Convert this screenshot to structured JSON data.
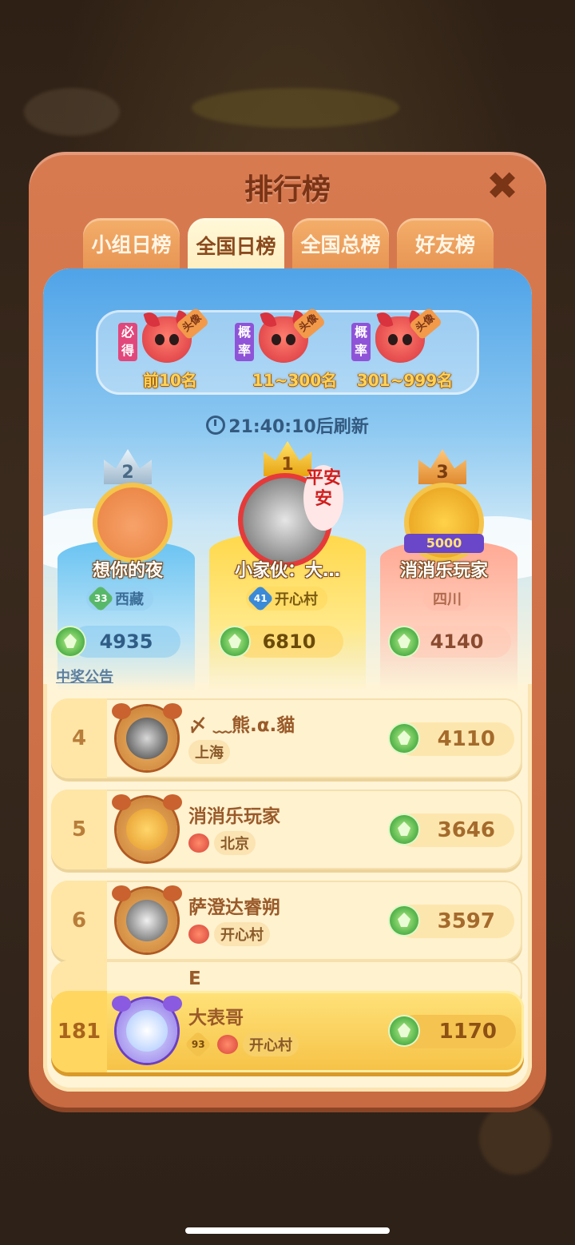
{
  "title": "排行榜",
  "tabs": [
    {
      "label": "小组日榜",
      "active": false
    },
    {
      "label": "全国日榜",
      "active": true
    },
    {
      "label": "全国总榜",
      "active": false
    },
    {
      "label": "好友榜",
      "active": false
    }
  ],
  "rewards": [
    {
      "tag": "必得",
      "tag_color": "#e2477b",
      "fox_tag": "头像",
      "range": "前10名"
    },
    {
      "tag": "概率",
      "tag_color": "#8f53d8",
      "fox_tag": "头像",
      "range": "11~300名"
    },
    {
      "tag": "概率",
      "tag_color": "#8f53d8",
      "fox_tag": "头像",
      "range": "301~999名"
    }
  ],
  "refresh_text": "21:40:10后刷新",
  "top3": {
    "second": {
      "crown": "2",
      "name": "想你的夜",
      "level": "33",
      "region": "西藏",
      "score": "4935"
    },
    "first": {
      "crown": "1",
      "name": "小家伙：大…",
      "level": "41",
      "region": "开心村",
      "score": "6810",
      "sticker": "平安安"
    },
    "third": {
      "crown": "3",
      "name": "消消乐玩家",
      "region": "四川",
      "score": "4140",
      "banner": "5000"
    }
  },
  "announcement": "中奖公告",
  "rows": [
    {
      "rank": "4",
      "name": "〆 ﹏熊.α.貓",
      "region": "上海",
      "score": "4110"
    },
    {
      "rank": "5",
      "name": "消消乐玩家",
      "region": "北京",
      "score": "3646"
    },
    {
      "rank": "6",
      "name": "萨澄达睿朔",
      "region": "开心村",
      "score": "3597"
    }
  ],
  "partial_row_name": "E",
  "my_row": {
    "rank": "181",
    "name": "大表哥",
    "level": "93",
    "region": "开心村",
    "score": "1170"
  },
  "colors": {
    "panel": "#d87a50",
    "accent_gold": "#ffd257",
    "gem": "#4fb048"
  }
}
